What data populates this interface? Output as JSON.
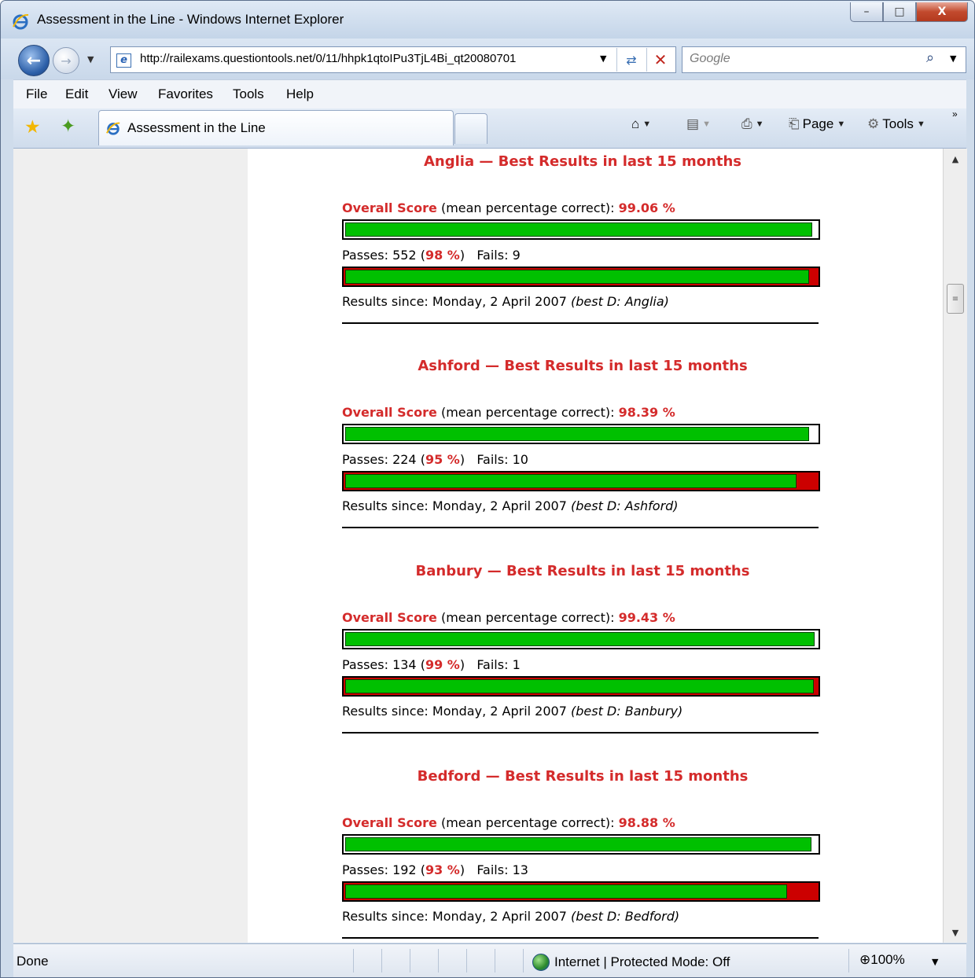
{
  "window": {
    "title": "Assessment in the Line - Windows Internet Explorer",
    "min": "–",
    "max": "□",
    "close": "X"
  },
  "nav": {
    "url": "http://railexams.questiontools.net/0/11/hhpk1qtoIPu3TjL4Bi_qt20080701",
    "search_placeholder": "Google"
  },
  "menu": [
    "File",
    "Edit",
    "View",
    "Favorites",
    "Tools",
    "Help"
  ],
  "tab": {
    "label": "Assessment in the Line"
  },
  "commands": {
    "page": "Page",
    "tools": "Tools"
  },
  "labels": {
    "overall_score": "Overall Score",
    "mean_text": " (mean percentage correct): ",
    "passes": "Passes: ",
    "fails": "Fails: ",
    "results_since": "Results since: "
  },
  "sections": [
    {
      "title": "Anglia — Best Results in last 15 months",
      "score": "99.06 %",
      "score_value": 99.06,
      "passes": "552",
      "pass_pct": "98 %",
      "pass_rate": 98.4,
      "fails": "9",
      "since": "Monday, 2 April 2007",
      "best": "(best D: Anglia)"
    },
    {
      "title": "Ashford — Best Results in last 15 months",
      "score": "98.39 %",
      "score_value": 98.39,
      "passes": "224",
      "pass_pct": "95 %",
      "pass_rate": 95.7,
      "fails": "10",
      "since": "Monday, 2 April 2007",
      "best": "(best D: Ashford)"
    },
    {
      "title": "Banbury — Best Results in last 15 months",
      "score": "99.43 %",
      "score_value": 99.43,
      "passes": "134",
      "pass_pct": "99 %",
      "pass_rate": 99.3,
      "fails": "1",
      "since": "Monday, 2 April 2007",
      "best": "(best D: Banbury)"
    },
    {
      "title": "Bedford — Best Results in last 15 months",
      "score": "98.88 %",
      "score_value": 98.88,
      "passes": "192",
      "pass_pct": "93 %",
      "pass_rate": 93.7,
      "fails": "13",
      "since": "Monday, 2 April 2007",
      "best": "(best D: Bedford)"
    }
  ],
  "status": {
    "text": "Done",
    "zone": "Internet | Protected Mode: Off",
    "zoom": "100%"
  }
}
